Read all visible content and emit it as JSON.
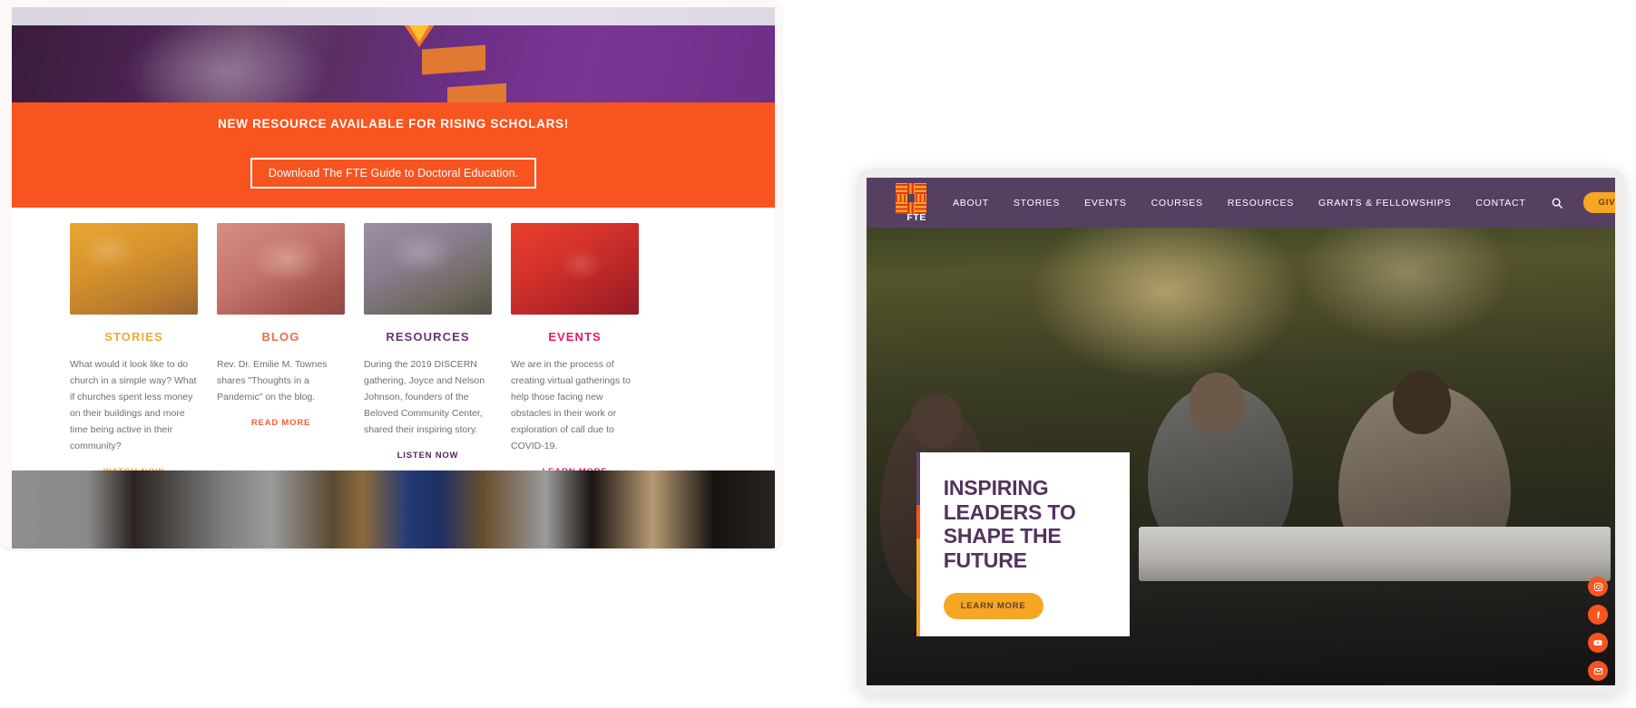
{
  "left_panel": {
    "announcement": {
      "title": "NEW RESOURCE AVAILABLE FOR RISING SCHOLARS!",
      "button_label": "Download The FTE Guide to Doctoral Education."
    },
    "cards": [
      {
        "title": "STORIES",
        "body": "What would it look like to do church in a simple way? What if churches spent less money on their buildings and more time being active in their community?",
        "cta": "WATCH NOW",
        "color": "#f0a92b"
      },
      {
        "title": "BLOG",
        "body": "Rev. Dr. Emilie M. Townes shares \"Thoughts in a Pandemic\" on the blog.",
        "cta": "READ MORE",
        "color": "#f26b4a"
      },
      {
        "title": "RESOURCES",
        "body": "During the 2019 DISCERN gathering, Joyce and Nelson Johnson, founders of the Beloved Community Center, shared their inspiring story.",
        "cta": "LISTEN NOW",
        "color": "#6d3177"
      },
      {
        "title": "EVENTS",
        "body": "We are in the process of creating virtual gatherings to help those facing new obstacles in their work or exploration of call due to COVID-19.",
        "cta": "LEARN MORE",
        "color": "#e8186a"
      }
    ]
  },
  "right_panel": {
    "nav": {
      "logo_text": "FTE",
      "logo_icon": "fte-woven-square-logo",
      "links": [
        {
          "label": "ABOUT"
        },
        {
          "label": "STORIES"
        },
        {
          "label": "EVENTS"
        },
        {
          "label": "COURSES"
        },
        {
          "label": "RESOURCES"
        },
        {
          "label": "GRANTS & FELLOWSHIPS"
        },
        {
          "label": "CONTACT"
        }
      ],
      "search_icon": "search-icon",
      "give_label": "GIVE",
      "background_color": "#554062"
    },
    "hero": {
      "heading": "INSPIRING LEADERS TO SHAPE THE FUTURE",
      "button_label": "LEARN MORE",
      "heading_color": "#54325f",
      "button_color": "#f5a623",
      "stripe_colors": [
        "#5c4470",
        "#f8541f",
        "#f5a623"
      ]
    },
    "social": [
      {
        "name": "instagram-icon"
      },
      {
        "name": "facebook-icon"
      },
      {
        "name": "youtube-icon"
      },
      {
        "name": "email-icon"
      }
    ]
  },
  "theme": {
    "orange": "#f8541f",
    "gold": "#f5a623",
    "purple": "#554062",
    "pink": "#e8186a"
  }
}
